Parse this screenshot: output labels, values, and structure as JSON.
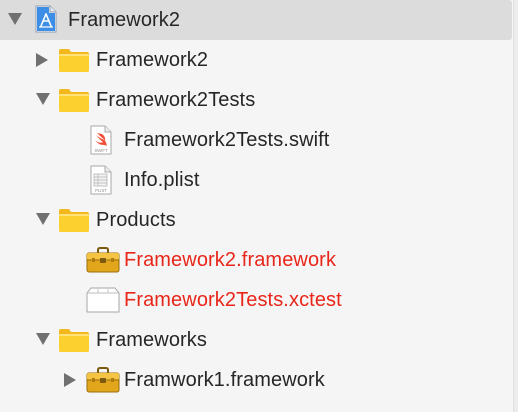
{
  "navigator": {
    "items": [
      {
        "label": "Framework2",
        "icon": "xcode-project-icon",
        "disclosure": "expanded"
      },
      {
        "label": "Framework2",
        "icon": "folder-icon",
        "disclosure": "collapsed"
      },
      {
        "label": "Framework2Tests",
        "icon": "folder-icon",
        "disclosure": "expanded"
      },
      {
        "label": "Framework2Tests.swift",
        "icon": "swift-file-icon",
        "disclosure": "none",
        "badge": "SWIFT"
      },
      {
        "label": "Info.plist",
        "icon": "plist-file-icon",
        "disclosure": "none",
        "badge": "PLIST"
      },
      {
        "label": "Products",
        "icon": "folder-icon",
        "disclosure": "expanded"
      },
      {
        "label": "Framework2.framework",
        "icon": "framework-toolbox-icon",
        "disclosure": "none",
        "missing": true
      },
      {
        "label": "Framework2Tests.xctest",
        "icon": "xctest-bundle-icon",
        "disclosure": "none",
        "missing": true
      },
      {
        "label": "Frameworks",
        "icon": "folder-icon",
        "disclosure": "expanded"
      },
      {
        "label": "Framwork1.framework",
        "icon": "framework-toolbox-icon",
        "disclosure": "collapsed"
      }
    ]
  },
  "colors": {
    "missing_file_text": "#e8261a",
    "folder_yellow": "#fcd02e",
    "selection": "#dcdcdc"
  }
}
